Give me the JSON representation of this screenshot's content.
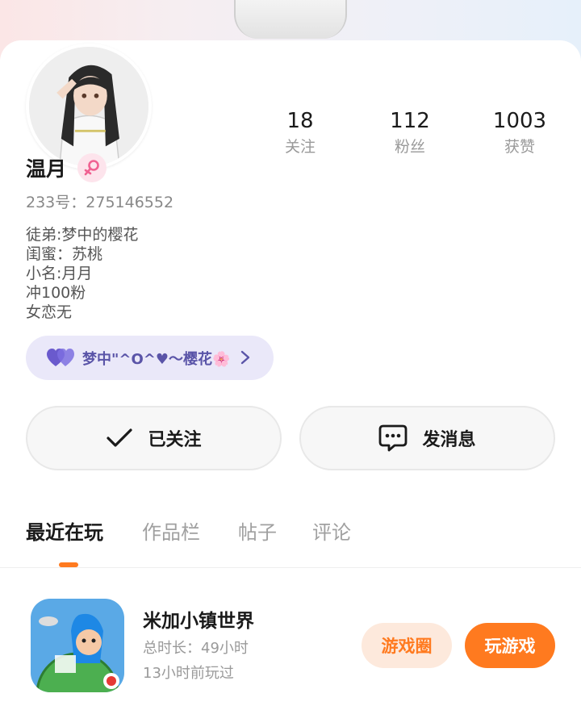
{
  "profile": {
    "name": "温月",
    "uid": "233号：275146552",
    "bio": [
      "徒弟:梦中的樱花",
      "闺蜜：苏桃",
      "小名:月月",
      "冲100粉",
      "女恋无"
    ],
    "relation_tag": "梦中\"^O^♥～樱花🌸"
  },
  "stats": [
    {
      "value": "18",
      "label": "关注"
    },
    {
      "value": "112",
      "label": "粉丝"
    },
    {
      "value": "1003",
      "label": "获赞"
    }
  ],
  "actions": {
    "follow_label": "已关注",
    "message_label": "发消息"
  },
  "tabs": [
    {
      "label": "最近在玩",
      "active": true
    },
    {
      "label": "作品栏",
      "active": false
    },
    {
      "label": "帖子",
      "active": false
    },
    {
      "label": "评论",
      "active": false
    }
  ],
  "recent_game": {
    "title": "米加小镇世界",
    "playtime": "总时长：49小时",
    "last_played": "13小时前玩过",
    "circle_label": "游戏圈",
    "play_label": "玩游戏"
  },
  "colors": {
    "accent": "#ff7a1f",
    "tag_bg": "#eae8f9",
    "tag_text": "#5a54a8",
    "gender_bg": "#fde4ec",
    "gender_icon": "#f06292"
  },
  "icons": {
    "gender": "female-icon",
    "tag": "heart-icon",
    "follow": "checkmark-icon",
    "message": "chat-bubble-icon"
  }
}
